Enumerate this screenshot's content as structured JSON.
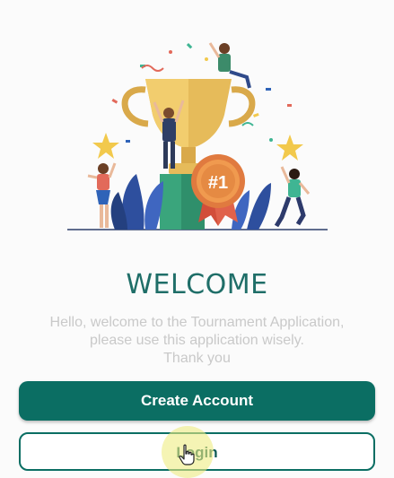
{
  "welcome": {
    "title": "WELCOME",
    "message_line1": "Hello, welcome to the Tournament Application,",
    "message_line2": "please use this application wisely.",
    "message_line3": "Thank you"
  },
  "illustration": {
    "icon": "trophy-celebration-illustration",
    "badge_text": "#1"
  },
  "buttons": {
    "create_account": "Create Account",
    "login": "Login"
  },
  "colors": {
    "primary": "#0b6e63",
    "title": "#1f6e68",
    "subtitle": "#c9c9c9"
  }
}
